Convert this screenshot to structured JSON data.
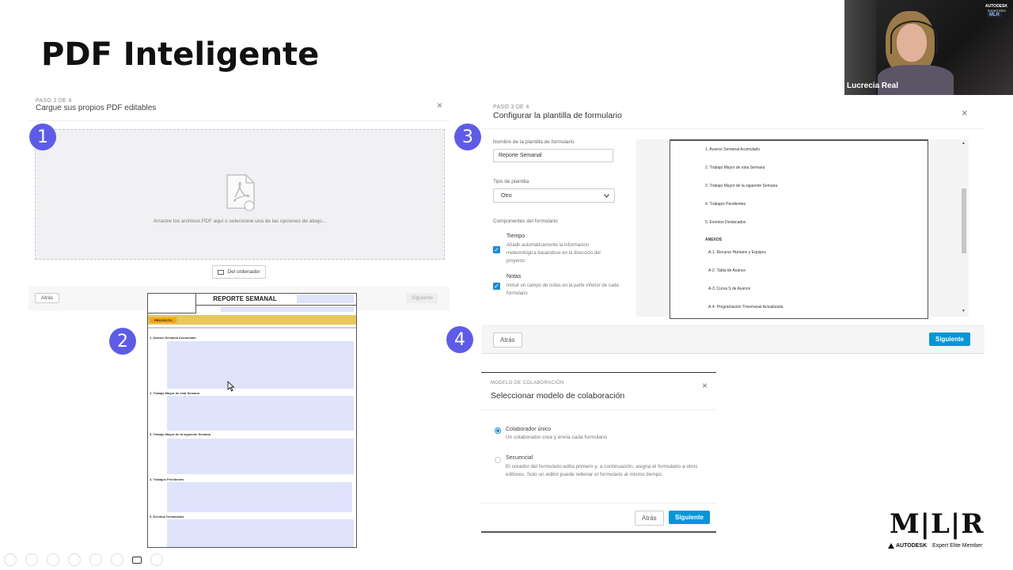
{
  "slide": {
    "title": "PDF Inteligente"
  },
  "steps": [
    "1",
    "2",
    "3",
    "4"
  ],
  "panel1": {
    "step_label": "PASO 2 DE 4",
    "title": "Cargue sus propios PDF editables",
    "close": "×",
    "drop_text": "Arrastre los archivos PDF aquí o seleccione una de las opciones de abajo...",
    "from_computer": "Del ordenador",
    "back": "Atrás",
    "next": "Siguiente"
  },
  "pdf": {
    "header": "REPORTE SEMANAL",
    "project_tag": "PROYECTO",
    "sections": [
      "1. Avance Semanal Acumulado",
      "2. Trabajo Mayor de esta Semana",
      "3. Trabajo Mayor de la siguiente Semana",
      "4. Trabajos Pendientes",
      "5. Eventos Destacados"
    ]
  },
  "panel3": {
    "step_label": "PASO 3 DE 4",
    "title": "Configurar la plantilla de formulario",
    "close": "×",
    "name_label": "Nombre de la plantilla de formulario",
    "name_value": "Reporte Semanal",
    "type_label": "Tipo de plantilla",
    "type_value": "Otro",
    "components_label": "Componentes del formulario",
    "components": [
      {
        "title": "Tiempo",
        "desc": "Añadir automáticamente la información meteorológica basándose en la dirección del proyecto",
        "checked": true
      },
      {
        "title": "Notas",
        "desc": "Incluir un campo de notas en la parte inferior de cada formulario",
        "checked": true
      }
    ],
    "preview_items": [
      "1. Avance Semanal Acumulado",
      "2. Trabajo Mayor de esta Semana",
      "3. Trabajo Mayor de la siguiente Semana",
      "4. Trabajos Pendientes",
      "5. Eventos Destacados",
      "ANEXOS",
      "A-1. Recurso Humano y Equipos",
      "A-2. Tabla de Avance",
      "A-3. Curva S de Avance",
      "A-4. Programación Trisemanal Actualizada"
    ],
    "back": "Atrás",
    "next": "Siguiente"
  },
  "panel4": {
    "step_label": "MODELO DE COLABORACIÓN",
    "title": "Seleccionar modelo de colaboración",
    "close": "×",
    "options": [
      {
        "title": "Colaborador único",
        "desc": "Un colaborador crea y envía cada formulario",
        "selected": true
      },
      {
        "title": "Secuencial",
        "desc": "El creador del formulario edita primero y, a continuación, asigna el formulario a otros editores. Solo un editor puede rellenar el formulario al mismo tiempo.",
        "selected": false
      }
    ],
    "back": "Atrás",
    "next": "Siguiente"
  },
  "webcam": {
    "name": "Lucrecia Real",
    "badge_top": "AUTODESK",
    "badge_sub": "Expert Elite",
    "badge_mlr": "MLR"
  },
  "logo": {
    "mlr": "M|L|R",
    "autodesk": "AUTODESK",
    "tagline": "Expert Elite Member"
  },
  "colors": {
    "accent_purple": "#5e5ce6",
    "autodesk_blue": "#0696d7",
    "pdf_header_yellow": "#e8c75b"
  }
}
